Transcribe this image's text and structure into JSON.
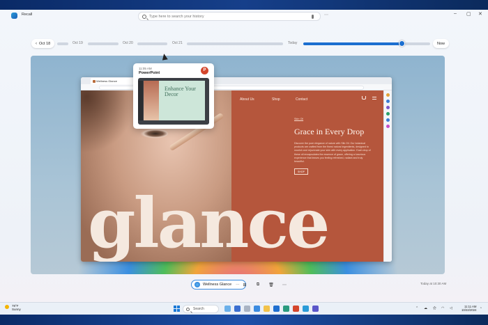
{
  "app": {
    "name": "Recall",
    "search_placeholder": "Type here to search your history"
  },
  "timeline": {
    "back_label": "Oct 18",
    "labels": [
      "Oct 19",
      "Oct 20",
      "Oct 21",
      "Today"
    ],
    "now_label": "Now",
    "position": 0.9
  },
  "popup": {
    "time": "11:05 AM",
    "app": "PowerPoint",
    "slide_title": "Enhance Your Decor"
  },
  "website": {
    "tab_title": "Wellness Glance",
    "nav": [
      "About Us",
      "Shop",
      "Contact"
    ],
    "kicker": "Skin Oil",
    "hero": "Grace in Every Drop",
    "body": "Discover the pure elegance of nature with Silk Oil. Our botanical products are crafted from the finest natural ingredients, designed to nourish and rejuvenate your skin with every application. Each drop of these oil encapsulates the essence of grace, offering a luxurious experience that leaves you feeling refreshed, radiant and truly beautiful.",
    "shop_button": "SHOP",
    "wordmark": "glance"
  },
  "toolbar": {
    "pill_label": "Wellness Glance",
    "more": "···",
    "timestamp": "Today at 10:30 AM"
  },
  "taskbar": {
    "weather_temp": "78°F",
    "weather_cond": "Sunny",
    "search_label": "Search",
    "time": "11:11 AM",
    "date": "10/22/2024"
  },
  "colors": {
    "accent": "#1c6fd0",
    "brand_panel": "#b5563c",
    "powerpoint": "#d4462c"
  }
}
